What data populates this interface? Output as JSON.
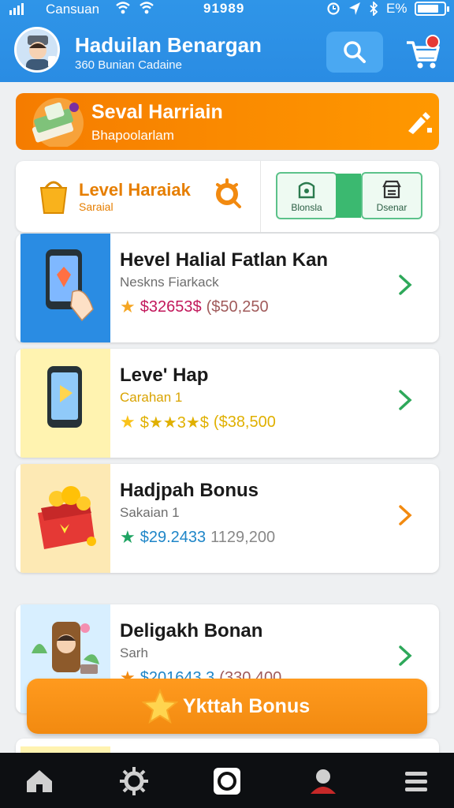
{
  "status_bar": {
    "carrier": "Cansuan",
    "time": "91989",
    "battery": "E%"
  },
  "header": {
    "title": "Haduilan Benargan",
    "subtitle": "360 Bunian Cadaine"
  },
  "banner": {
    "title": "Seval Harriain",
    "subtitle": "Bhapoolarlam"
  },
  "level_card": {
    "title": "Level Haraiak",
    "subtitle": "Saraial",
    "segments": [
      "Blonsla",
      "Dsenar"
    ]
  },
  "items": [
    {
      "title": "Hevel Halial Fatlan Kan",
      "subtitle": "Neskns Fiarkack",
      "price": "$32653$",
      "alt_price": "($50,250"
    },
    {
      "title": "Leve' Hap",
      "subtitle": "Carahan 1",
      "price": "$★★3★$",
      "alt_price": "($38,500"
    },
    {
      "title": "Hadjpah Bonus",
      "subtitle": "Sakaian 1",
      "price": "$29.2433",
      "alt_price": "1129,200"
    },
    {
      "title": "Deligakh Bonan",
      "subtitle": "Sarh",
      "price": "$201643.3",
      "alt_price": "(330 400"
    }
  ],
  "bonus_button": {
    "label": "Ykttah Bonus"
  },
  "nav": {
    "items": [
      "home-icon",
      "gear-icon",
      "record-icon",
      "profile-icon",
      "menu-icon"
    ]
  },
  "colors": {
    "header_blue": "#2a8ce3",
    "accent_orange": "#f57c00",
    "chevron_green": "#2ea85a",
    "chevron_orange": "#f28a10",
    "price_pink": "#c2185b"
  }
}
